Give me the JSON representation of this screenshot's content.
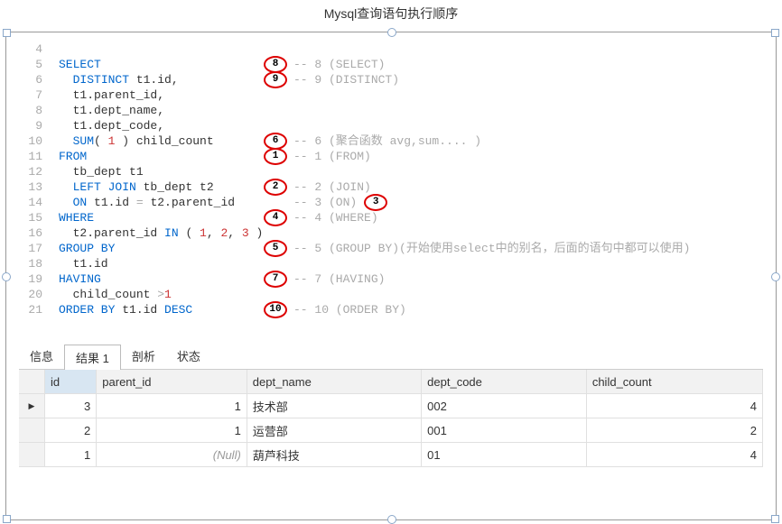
{
  "title": "Mysql查询语句执行顺序",
  "code_lines": [
    {
      "n": "4",
      "tokens": [],
      "badge": null,
      "comment": ""
    },
    {
      "n": "5",
      "tokens": [
        {
          "t": "SELECT",
          "c": "kw"
        }
      ],
      "badge": "8",
      "comment": "-- 8 (SELECT)"
    },
    {
      "n": "6",
      "tokens": [
        {
          "t": "  ",
          "c": ""
        },
        {
          "t": "DISTINCT",
          "c": "kw"
        },
        {
          "t": " t1.id,",
          "c": ""
        }
      ],
      "badge": "9",
      "comment": "-- 9 (DISTINCT)"
    },
    {
      "n": "7",
      "tokens": [
        {
          "t": "  t1.parent_id,",
          "c": ""
        }
      ],
      "badge": null,
      "comment": ""
    },
    {
      "n": "8",
      "tokens": [
        {
          "t": "  t1.dept_name,",
          "c": ""
        }
      ],
      "badge": null,
      "comment": ""
    },
    {
      "n": "9",
      "tokens": [
        {
          "t": "  t1.dept_code,",
          "c": ""
        }
      ],
      "badge": null,
      "comment": ""
    },
    {
      "n": "10",
      "tokens": [
        {
          "t": "  ",
          "c": ""
        },
        {
          "t": "SUM",
          "c": "kw"
        },
        {
          "t": "( ",
          "c": ""
        },
        {
          "t": "1",
          "c": "num"
        },
        {
          "t": " ) child_count",
          "c": ""
        }
      ],
      "badge": "6",
      "comment": "-- 6 (聚合函数 avg,sum.... )"
    },
    {
      "n": "11",
      "tokens": [
        {
          "t": "FROM",
          "c": "kw"
        }
      ],
      "badge": "1",
      "comment": "-- 1 (FROM)"
    },
    {
      "n": "12",
      "tokens": [
        {
          "t": "  tb_dept t1",
          "c": ""
        }
      ],
      "badge": null,
      "comment": ""
    },
    {
      "n": "13",
      "tokens": [
        {
          "t": "  ",
          "c": ""
        },
        {
          "t": "LEFT JOIN",
          "c": "kw"
        },
        {
          "t": " tb_dept t2",
          "c": ""
        }
      ],
      "badge": "2",
      "comment": "-- 2 (JOIN)"
    },
    {
      "n": "14",
      "tokens": [
        {
          "t": "  ",
          "c": ""
        },
        {
          "t": "ON",
          "c": "kw"
        },
        {
          "t": " t1.id ",
          "c": ""
        },
        {
          "t": "=",
          "c": "gray"
        },
        {
          "t": " t2.parent_id",
          "c": ""
        }
      ],
      "badge": null,
      "comment": "-- 3 (ON)",
      "extra_badge": "3"
    },
    {
      "n": "15",
      "tokens": [
        {
          "t": "WHERE",
          "c": "kw"
        }
      ],
      "badge": "4",
      "comment": "-- 4 (WHERE)"
    },
    {
      "n": "16",
      "tokens": [
        {
          "t": "  t2.parent_id ",
          "c": ""
        },
        {
          "t": "IN",
          "c": "kw"
        },
        {
          "t": " ( ",
          "c": ""
        },
        {
          "t": "1",
          "c": "num"
        },
        {
          "t": ", ",
          "c": ""
        },
        {
          "t": "2",
          "c": "num"
        },
        {
          "t": ", ",
          "c": ""
        },
        {
          "t": "3",
          "c": "num"
        },
        {
          "t": " )",
          "c": ""
        }
      ],
      "badge": null,
      "comment": ""
    },
    {
      "n": "17",
      "tokens": [
        {
          "t": "GROUP BY",
          "c": "kw"
        }
      ],
      "badge": "5",
      "comment": "-- 5 (GROUP BY)(开始使用select中的别名，后面的语句中都可以使用)"
    },
    {
      "n": "18",
      "tokens": [
        {
          "t": "  t1.id",
          "c": ""
        }
      ],
      "badge": null,
      "comment": ""
    },
    {
      "n": "19",
      "tokens": [
        {
          "t": "HAVING",
          "c": "kw"
        }
      ],
      "badge": "7",
      "comment": "-- 7 (HAVING)"
    },
    {
      "n": "20",
      "tokens": [
        {
          "t": "  child_count ",
          "c": ""
        },
        {
          "t": ">",
          "c": "gray"
        },
        {
          "t": "1",
          "c": "num"
        }
      ],
      "badge": null,
      "comment": ""
    },
    {
      "n": "21",
      "tokens": [
        {
          "t": "ORDER BY",
          "c": "kw"
        },
        {
          "t": " t1.id ",
          "c": ""
        },
        {
          "t": "DESC",
          "c": "kw"
        }
      ],
      "badge": "10",
      "comment": "-- 10 (ORDER BY)"
    }
  ],
  "tabs": [
    "信息",
    "结果 1",
    "剖析",
    "状态"
  ],
  "active_tab": 1,
  "table": {
    "columns": [
      "id",
      "parent_id",
      "dept_name",
      "dept_code",
      "child_count"
    ],
    "rows": [
      {
        "cursor": true,
        "id": "3",
        "parent_id": "1",
        "dept_name": "技术部",
        "dept_code": "002",
        "child_count": "4"
      },
      {
        "cursor": false,
        "id": "2",
        "parent_id": "1",
        "dept_name": "运营部",
        "dept_code": "001",
        "child_count": "2"
      },
      {
        "cursor": false,
        "id": "1",
        "parent_id": "(Null)",
        "dept_name": "葫芦科技",
        "dept_code": "01",
        "child_count": "4"
      }
    ]
  }
}
